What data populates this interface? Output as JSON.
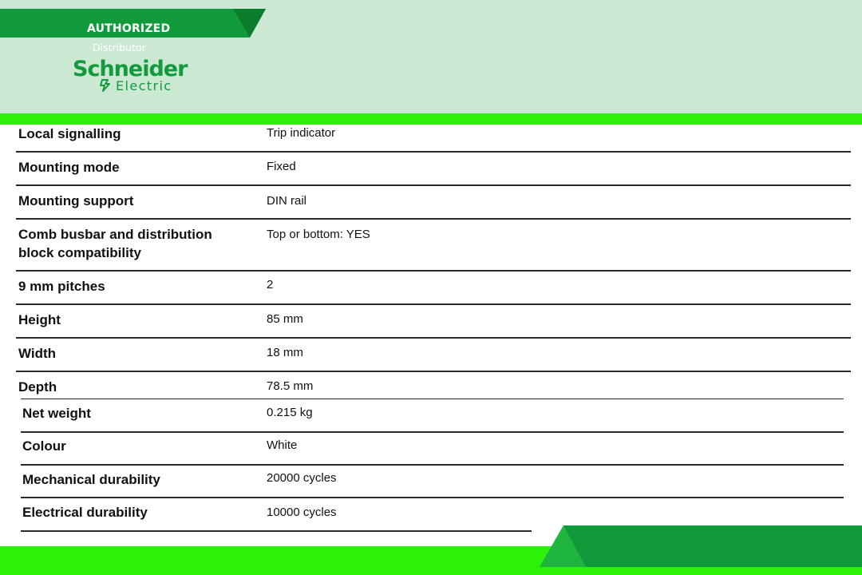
{
  "header": {
    "authorized": "AUTHORIZED",
    "distributor": "Distributor",
    "brand_name": "Schneider",
    "brand_sub": "Electric",
    "colors": {
      "header_bg": "#cae8d2",
      "banner_green": "#119a3c",
      "bright_green": "#2cf20a",
      "brand_green": "#139a3d"
    }
  },
  "specs": [
    {
      "label": "Local signalling",
      "value": "Trip indicator"
    },
    {
      "label": "Mounting mode",
      "value": "Fixed"
    },
    {
      "label": "Mounting support",
      "value": "DIN rail"
    },
    {
      "label": "Comb busbar and distribution",
      "label2": "block compatibility",
      "value": "Top or bottom: YES"
    },
    {
      "label": "9 mm pitches",
      "value": "2"
    },
    {
      "label": "Height",
      "value": "85 mm"
    },
    {
      "label": "Width",
      "value": "18 mm"
    },
    {
      "label": "Depth",
      "value": "78.5 mm"
    },
    {
      "label": "Net weight",
      "value": "0.215 kg"
    },
    {
      "label": "Colour",
      "value": "White"
    },
    {
      "label": "Mechanical durability",
      "value": "20000 cycles"
    },
    {
      "label": "Electrical durability",
      "value": "10000 cycles"
    }
  ]
}
